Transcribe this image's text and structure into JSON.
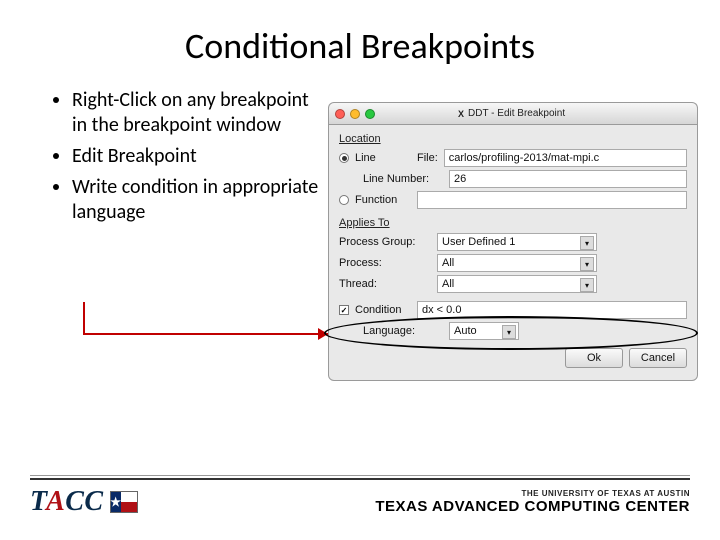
{
  "title": "Conditional Breakpoints",
  "bullets": [
    "Right-Click on any breakpoint in the breakpoint window",
    " Edit Breakpoint",
    "Write condition in appropriate language"
  ],
  "dialog": {
    "windowTitle": "DDT - Edit Breakpoint",
    "location": {
      "header": "Location",
      "lineRadio": "Line",
      "fileLabel": "File:",
      "fileValue": "carlos/profiling-2013/mat-mpi.c",
      "lineNumberLabel": "Line Number:",
      "lineNumberValue": "26",
      "functionRadio": "Function",
      "functionValue": ""
    },
    "applies": {
      "header": "Applies To",
      "processGroupLabel": "Process Group:",
      "processGroupValue": "User Defined 1",
      "processLabel": "Process:",
      "processValue": "All",
      "threadLabel": "Thread:",
      "threadValue": "All"
    },
    "condition": {
      "checkboxLabel": "Condition",
      "value": "dx < 0.0",
      "languageLabel": "Language:",
      "languageValue": "Auto"
    },
    "buttons": {
      "ok": "Ok",
      "cancel": "Cancel"
    }
  },
  "footer": {
    "taccPrefix": "T",
    "taccA": "A",
    "taccSuffix": "CC",
    "utSub": "THE UNIVERSITY OF TEXAS AT AUSTIN",
    "utMain": "TEXAS ADVANCED COMPUTING CENTER"
  }
}
